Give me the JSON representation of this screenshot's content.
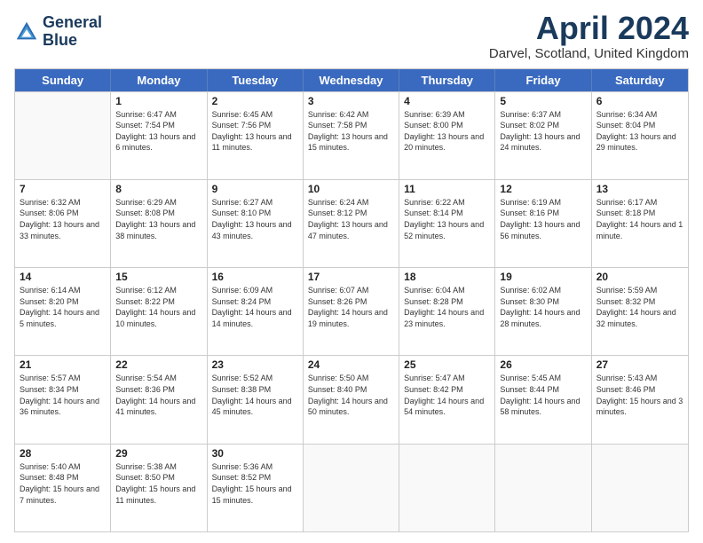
{
  "header": {
    "logo_line1": "General",
    "logo_line2": "Blue",
    "title": "April 2024",
    "location": "Darvel, Scotland, United Kingdom"
  },
  "days": [
    "Sunday",
    "Monday",
    "Tuesday",
    "Wednesday",
    "Thursday",
    "Friday",
    "Saturday"
  ],
  "weeks": [
    [
      {
        "day": "",
        "sunrise": "",
        "sunset": "",
        "daylight": ""
      },
      {
        "day": "1",
        "sunrise": "Sunrise: 6:47 AM",
        "sunset": "Sunset: 7:54 PM",
        "daylight": "Daylight: 13 hours and 6 minutes."
      },
      {
        "day": "2",
        "sunrise": "Sunrise: 6:45 AM",
        "sunset": "Sunset: 7:56 PM",
        "daylight": "Daylight: 13 hours and 11 minutes."
      },
      {
        "day": "3",
        "sunrise": "Sunrise: 6:42 AM",
        "sunset": "Sunset: 7:58 PM",
        "daylight": "Daylight: 13 hours and 15 minutes."
      },
      {
        "day": "4",
        "sunrise": "Sunrise: 6:39 AM",
        "sunset": "Sunset: 8:00 PM",
        "daylight": "Daylight: 13 hours and 20 minutes."
      },
      {
        "day": "5",
        "sunrise": "Sunrise: 6:37 AM",
        "sunset": "Sunset: 8:02 PM",
        "daylight": "Daylight: 13 hours and 24 minutes."
      },
      {
        "day": "6",
        "sunrise": "Sunrise: 6:34 AM",
        "sunset": "Sunset: 8:04 PM",
        "daylight": "Daylight: 13 hours and 29 minutes."
      }
    ],
    [
      {
        "day": "7",
        "sunrise": "Sunrise: 6:32 AM",
        "sunset": "Sunset: 8:06 PM",
        "daylight": "Daylight: 13 hours and 33 minutes."
      },
      {
        "day": "8",
        "sunrise": "Sunrise: 6:29 AM",
        "sunset": "Sunset: 8:08 PM",
        "daylight": "Daylight: 13 hours and 38 minutes."
      },
      {
        "day": "9",
        "sunrise": "Sunrise: 6:27 AM",
        "sunset": "Sunset: 8:10 PM",
        "daylight": "Daylight: 13 hours and 43 minutes."
      },
      {
        "day": "10",
        "sunrise": "Sunrise: 6:24 AM",
        "sunset": "Sunset: 8:12 PM",
        "daylight": "Daylight: 13 hours and 47 minutes."
      },
      {
        "day": "11",
        "sunrise": "Sunrise: 6:22 AM",
        "sunset": "Sunset: 8:14 PM",
        "daylight": "Daylight: 13 hours and 52 minutes."
      },
      {
        "day": "12",
        "sunrise": "Sunrise: 6:19 AM",
        "sunset": "Sunset: 8:16 PM",
        "daylight": "Daylight: 13 hours and 56 minutes."
      },
      {
        "day": "13",
        "sunrise": "Sunrise: 6:17 AM",
        "sunset": "Sunset: 8:18 PM",
        "daylight": "Daylight: 14 hours and 1 minute."
      }
    ],
    [
      {
        "day": "14",
        "sunrise": "Sunrise: 6:14 AM",
        "sunset": "Sunset: 8:20 PM",
        "daylight": "Daylight: 14 hours and 5 minutes."
      },
      {
        "day": "15",
        "sunrise": "Sunrise: 6:12 AM",
        "sunset": "Sunset: 8:22 PM",
        "daylight": "Daylight: 14 hours and 10 minutes."
      },
      {
        "day": "16",
        "sunrise": "Sunrise: 6:09 AM",
        "sunset": "Sunset: 8:24 PM",
        "daylight": "Daylight: 14 hours and 14 minutes."
      },
      {
        "day": "17",
        "sunrise": "Sunrise: 6:07 AM",
        "sunset": "Sunset: 8:26 PM",
        "daylight": "Daylight: 14 hours and 19 minutes."
      },
      {
        "day": "18",
        "sunrise": "Sunrise: 6:04 AM",
        "sunset": "Sunset: 8:28 PM",
        "daylight": "Daylight: 14 hours and 23 minutes."
      },
      {
        "day": "19",
        "sunrise": "Sunrise: 6:02 AM",
        "sunset": "Sunset: 8:30 PM",
        "daylight": "Daylight: 14 hours and 28 minutes."
      },
      {
        "day": "20",
        "sunrise": "Sunrise: 5:59 AM",
        "sunset": "Sunset: 8:32 PM",
        "daylight": "Daylight: 14 hours and 32 minutes."
      }
    ],
    [
      {
        "day": "21",
        "sunrise": "Sunrise: 5:57 AM",
        "sunset": "Sunset: 8:34 PM",
        "daylight": "Daylight: 14 hours and 36 minutes."
      },
      {
        "day": "22",
        "sunrise": "Sunrise: 5:54 AM",
        "sunset": "Sunset: 8:36 PM",
        "daylight": "Daylight: 14 hours and 41 minutes."
      },
      {
        "day": "23",
        "sunrise": "Sunrise: 5:52 AM",
        "sunset": "Sunset: 8:38 PM",
        "daylight": "Daylight: 14 hours and 45 minutes."
      },
      {
        "day": "24",
        "sunrise": "Sunrise: 5:50 AM",
        "sunset": "Sunset: 8:40 PM",
        "daylight": "Daylight: 14 hours and 50 minutes."
      },
      {
        "day": "25",
        "sunrise": "Sunrise: 5:47 AM",
        "sunset": "Sunset: 8:42 PM",
        "daylight": "Daylight: 14 hours and 54 minutes."
      },
      {
        "day": "26",
        "sunrise": "Sunrise: 5:45 AM",
        "sunset": "Sunset: 8:44 PM",
        "daylight": "Daylight: 14 hours and 58 minutes."
      },
      {
        "day": "27",
        "sunrise": "Sunrise: 5:43 AM",
        "sunset": "Sunset: 8:46 PM",
        "daylight": "Daylight: 15 hours and 3 minutes."
      }
    ],
    [
      {
        "day": "28",
        "sunrise": "Sunrise: 5:40 AM",
        "sunset": "Sunset: 8:48 PM",
        "daylight": "Daylight: 15 hours and 7 minutes."
      },
      {
        "day": "29",
        "sunrise": "Sunrise: 5:38 AM",
        "sunset": "Sunset: 8:50 PM",
        "daylight": "Daylight: 15 hours and 11 minutes."
      },
      {
        "day": "30",
        "sunrise": "Sunrise: 5:36 AM",
        "sunset": "Sunset: 8:52 PM",
        "daylight": "Daylight: 15 hours and 15 minutes."
      },
      {
        "day": "",
        "sunrise": "",
        "sunset": "",
        "daylight": ""
      },
      {
        "day": "",
        "sunrise": "",
        "sunset": "",
        "daylight": ""
      },
      {
        "day": "",
        "sunrise": "",
        "sunset": "",
        "daylight": ""
      },
      {
        "day": "",
        "sunrise": "",
        "sunset": "",
        "daylight": ""
      }
    ]
  ]
}
